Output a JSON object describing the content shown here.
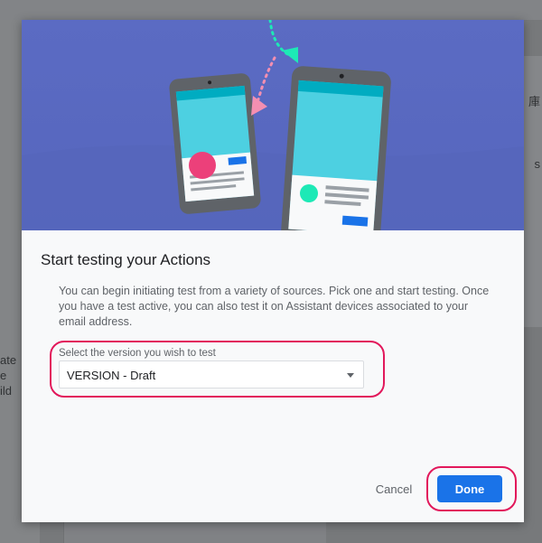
{
  "background": {
    "left_snippets": [
      "ate",
      "e",
      "ild"
    ],
    "right_snippets": [
      "庫",
      "s"
    ]
  },
  "dialog": {
    "title": "Start testing your Actions",
    "description": "You can begin initiating test from a variety of sources. Pick one and start testing. Once you have a test active, you can also test it on Assistant devices associated to your email address.",
    "select_label": "Select the version you wish to test",
    "select_value": "VERSION - Draft",
    "cancel_label": "Cancel",
    "done_label": "Done"
  },
  "colors": {
    "hero_background": "#5b6bc3",
    "accent": "#1a73e8",
    "highlight": "#e2185b",
    "arrow_pink": "#f48fb1",
    "arrow_teal": "#1de9b6",
    "screen": "#4dd0e1"
  }
}
